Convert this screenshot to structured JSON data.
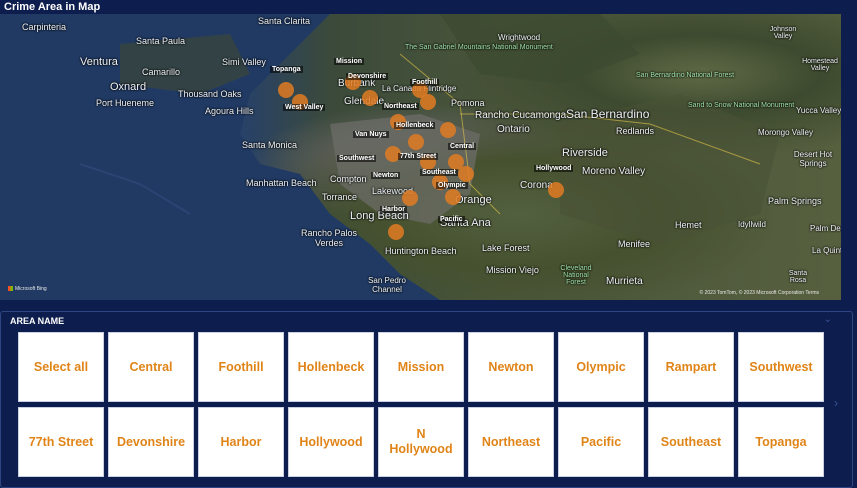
{
  "map": {
    "title": "Crime Area in Map",
    "attribution": "© 2023 TomTom, © 2023 Microsoft Corporation Terms",
    "provider": "Microsoft Bing",
    "places": [
      {
        "name": "Santa Clarita"
      },
      {
        "name": "Carpinteria"
      },
      {
        "name": "Santa Paula"
      },
      {
        "name": "Ventura"
      },
      {
        "name": "Camarillo"
      },
      {
        "name": "Oxnard"
      },
      {
        "name": "Simi Valley"
      },
      {
        "name": "Port Hueneme"
      },
      {
        "name": "Thousand Oaks"
      },
      {
        "name": "Agoura Hills"
      },
      {
        "name": "Santa Monica"
      },
      {
        "name": "Manhattan Beach"
      },
      {
        "name": "Torrance"
      },
      {
        "name": "Rancho Palos Verdes"
      },
      {
        "name": "San Pedro Channel"
      },
      {
        "name": "Huntington Beach"
      },
      {
        "name": "Lake Forest"
      },
      {
        "name": "Mission Viejo"
      },
      {
        "name": "Wrightwood"
      },
      {
        "name": "Rancho Cucamonga"
      },
      {
        "name": "Ontario"
      },
      {
        "name": "San Bernardino"
      },
      {
        "name": "Redlands"
      },
      {
        "name": "Riverside"
      },
      {
        "name": "Moreno Valley"
      },
      {
        "name": "Corona"
      },
      {
        "name": "Hemet"
      },
      {
        "name": "Idyllwild"
      },
      {
        "name": "Menifee"
      },
      {
        "name": "Murrieta"
      },
      {
        "name": "Johnson Valley"
      },
      {
        "name": "Homestead Valley"
      },
      {
        "name": "Yucca Valley"
      },
      {
        "name": "Morongo Valley"
      },
      {
        "name": "Desert Hot Springs"
      },
      {
        "name": "Palm Springs"
      },
      {
        "name": "Palm Desert"
      },
      {
        "name": "La Quinta"
      },
      {
        "name": "Santa Rosa"
      },
      {
        "name": "La Canada Flintridge"
      },
      {
        "name": "Pomona"
      },
      {
        "name": "Burbank"
      },
      {
        "name": "Glendale"
      },
      {
        "name": "Compton"
      },
      {
        "name": "Lakewood"
      },
      {
        "name": "Long Beach"
      },
      {
        "name": "Orange"
      },
      {
        "name": "Santa Ana"
      },
      {
        "name": "The San Gabriel Mountains National Monument"
      },
      {
        "name": "San Bernardino National Forest"
      },
      {
        "name": "Sand to Snow National Monument"
      },
      {
        "name": "Cleveland National Forest"
      }
    ],
    "areas": [
      {
        "name": "Mission"
      },
      {
        "name": "Topanga"
      },
      {
        "name": "Devonshire"
      },
      {
        "name": "Foothill"
      },
      {
        "name": "West Valley"
      },
      {
        "name": "Van Nuys"
      },
      {
        "name": "Northeast"
      },
      {
        "name": "Hollenbeck"
      },
      {
        "name": "Central"
      },
      {
        "name": "Southwest"
      },
      {
        "name": "77th Street"
      },
      {
        "name": "Newton"
      },
      {
        "name": "Southeast"
      },
      {
        "name": "Hollywood"
      },
      {
        "name": "Olympic"
      },
      {
        "name": "Harbor"
      },
      {
        "name": "Pacific"
      }
    ]
  },
  "slicer": {
    "title": "AREA NAME",
    "options": [
      "Select all",
      "Central",
      "Foothill",
      "Hollenbeck",
      "Mission",
      "Newton",
      "Olympic",
      "Rampart",
      "Southwest",
      "77th Street",
      "Devonshire",
      "Harbor",
      "Hollywood",
      "N Hollywood",
      "Northeast",
      "Pacific",
      "Southeast",
      "Topanga"
    ]
  },
  "colors": {
    "background": "#0d1d4d",
    "bubble": "#e07b22",
    "tile_text": "#e08418",
    "tile_bg": "#ffffff"
  }
}
